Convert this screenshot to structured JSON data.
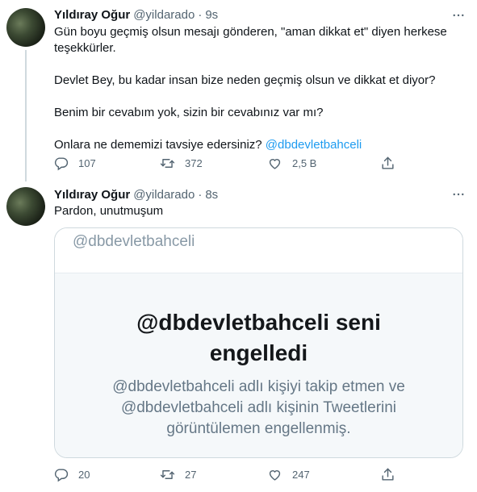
{
  "tweets": [
    {
      "name": "Yıldıray Oğur",
      "handle": "@yildarado",
      "separator": "·",
      "time": "9s",
      "lines": [
        "Gün boyu geçmiş olsun mesajı gönderen, \"aman dikkat et\" diyen herkese",
        "teşekkürler.",
        "Devlet Bey, bu kadar insan bize neden geçmiş olsun ve dikkat et diyor?",
        "Benim bir cevabım yok, sizin bir cevabınız var mı?",
        "Onlara ne dememizi tavsiye edersiniz? "
      ],
      "mention": "@dbdevletbahceli",
      "reply_count": "107",
      "retweet_count": "372",
      "like_count": "2,5 B"
    },
    {
      "name": "Yıldıray Oğur",
      "handle": "@yildarado",
      "separator": "·",
      "time": "8s",
      "lines": [
        "Pardon, unutmuşum"
      ],
      "card": {
        "handle": "@dbdevletbahceli",
        "title_line1": "@dbdevletbahceli seni",
        "title_line2": "engelledi",
        "desc_line1": "@dbdevletbahceli adlı kişiyi takip etmen ve",
        "desc_line2": "@dbdevletbahceli adlı kişinin Tweetlerini",
        "desc_line3": "görüntülemen engellenmiş."
      },
      "reply_count": "20",
      "retweet_count": "27",
      "like_count": "247"
    }
  ],
  "icons": {
    "reply": "reply-icon",
    "retweet": "retweet-icon",
    "like": "like-icon",
    "share": "share-icon",
    "more": "more-icon"
  },
  "colors": {
    "accent": "#1d9bf0",
    "muted": "#536471",
    "text": "#0f1419"
  }
}
